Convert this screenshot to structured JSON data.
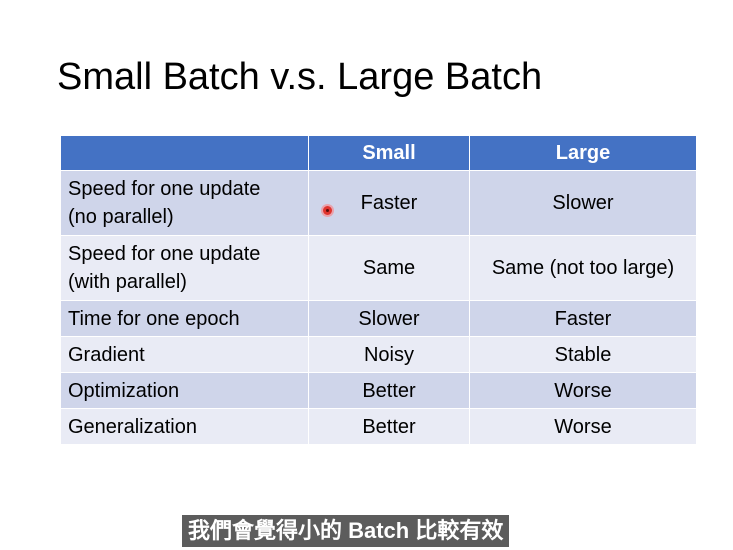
{
  "slide": {
    "title": "Small Batch v.s. Large Batch"
  },
  "table": {
    "headers": [
      "",
      "Small",
      "Large"
    ],
    "rows": [
      {
        "label": [
          "Speed for one update",
          "(no parallel)"
        ],
        "small": "Faster",
        "large": "Slower"
      },
      {
        "label": [
          "Speed for one update",
          "(with parallel)"
        ],
        "small": "Same",
        "large": "Same (not too large)"
      },
      {
        "label": [
          "Time for one epoch"
        ],
        "small": "Slower",
        "large": "Faster"
      },
      {
        "label": [
          "Gradient"
        ],
        "small": "Noisy",
        "large": "Stable"
      },
      {
        "label": [
          "Optimization"
        ],
        "small": "Better",
        "large": "Worse"
      },
      {
        "label": [
          "Generalization"
        ],
        "small": "Better",
        "large": "Worse"
      }
    ]
  },
  "subtitle": {
    "text": "我們會覺得小的 Batch 比較有效"
  },
  "colors": {
    "header_bg": "#4472c4",
    "row_odd_bg": "#cfd5ea",
    "row_even_bg": "#e9ebf5",
    "cursor": "#e0342e"
  },
  "icons": {
    "cursor": "laser-pointer-icon"
  }
}
